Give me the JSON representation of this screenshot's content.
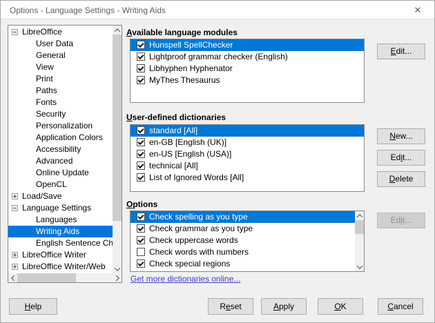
{
  "colors": {
    "accent": "#0078d7",
    "link": "#3e3ec9",
    "dialog_bg": "#f0f0f0",
    "titlebar_bg": "#ffffff"
  },
  "window": {
    "title": "Options - Language Settings - Writing Aids",
    "close_glyph": "✕"
  },
  "tree": {
    "items": [
      {
        "label": "LibreOffice",
        "level": 0,
        "expander": "minus"
      },
      {
        "label": "User Data",
        "level": 1
      },
      {
        "label": "General",
        "level": 1
      },
      {
        "label": "View",
        "level": 1
      },
      {
        "label": "Print",
        "level": 1
      },
      {
        "label": "Paths",
        "level": 1
      },
      {
        "label": "Fonts",
        "level": 1
      },
      {
        "label": "Security",
        "level": 1
      },
      {
        "label": "Personalization",
        "level": 1
      },
      {
        "label": "Application Colors",
        "level": 1
      },
      {
        "label": "Accessibility",
        "level": 1
      },
      {
        "label": "Advanced",
        "level": 1
      },
      {
        "label": "Online Update",
        "level": 1
      },
      {
        "label": "OpenCL",
        "level": 1
      },
      {
        "label": "Load/Save",
        "level": 0,
        "expander": "plus"
      },
      {
        "label": "Language Settings",
        "level": 0,
        "expander": "minus"
      },
      {
        "label": "Languages",
        "level": 1
      },
      {
        "label": "Writing Aids",
        "level": 1,
        "selected": true
      },
      {
        "label": "English Sentence Chec",
        "level": 1
      },
      {
        "label": "LibreOffice Writer",
        "level": 0,
        "expander": "plus"
      },
      {
        "label": "LibreOffice Writer/Web",
        "level": 0,
        "expander": "plus"
      }
    ]
  },
  "modules": {
    "label": "Available language modules",
    "mnemonic": "A",
    "items": [
      {
        "label": "Hunspell SpellChecker",
        "checked": true,
        "selected": true
      },
      {
        "label": "Lightproof grammar checker (English)",
        "checked": true
      },
      {
        "label": "Libhyphen Hyphenator",
        "checked": true
      },
      {
        "label": "MyThes Thesaurus",
        "checked": true
      }
    ],
    "edit_button": {
      "label": "Edit...",
      "mnemonic": "E"
    }
  },
  "dictionaries": {
    "label": "User-defined dictionaries",
    "mnemonic": "U",
    "items": [
      {
        "label": "standard [All]",
        "checked": true,
        "selected": true
      },
      {
        "label": "en-GB [English (UK)]",
        "checked": true
      },
      {
        "label": "en-US [English (USA)]",
        "checked": true
      },
      {
        "label": "technical [All]",
        "checked": true
      },
      {
        "label": "List of Ignored Words [All]",
        "checked": true
      }
    ],
    "new_button": {
      "label": "New...",
      "mnemonic": "N"
    },
    "edit_button": {
      "label": "Edit...",
      "mnemonic": "i"
    },
    "delete_button": {
      "label": "Delete",
      "mnemonic": "D"
    }
  },
  "options": {
    "label": "Options",
    "mnemonic": "O",
    "items": [
      {
        "label": "Check spelling as you type",
        "checked": true,
        "selected": true
      },
      {
        "label": "Check grammar as you type",
        "checked": true
      },
      {
        "label": "Check uppercase words",
        "checked": true
      },
      {
        "label": "Check words with numbers",
        "checked": false
      },
      {
        "label": "Check special regions",
        "checked": true
      }
    ],
    "edit_button": {
      "label": "Edit...",
      "mnemonic": "i",
      "disabled": true
    },
    "link": "Get more dictionaries online..."
  },
  "footer": {
    "help": {
      "label": "Help",
      "mnemonic": "H"
    },
    "reset": {
      "label": "Reset",
      "mnemonic": "e"
    },
    "apply": {
      "label": "Apply",
      "mnemonic": "A"
    },
    "ok": {
      "label": "OK",
      "mnemonic": "O"
    },
    "cancel": {
      "label": "Cancel",
      "mnemonic": "C"
    }
  }
}
